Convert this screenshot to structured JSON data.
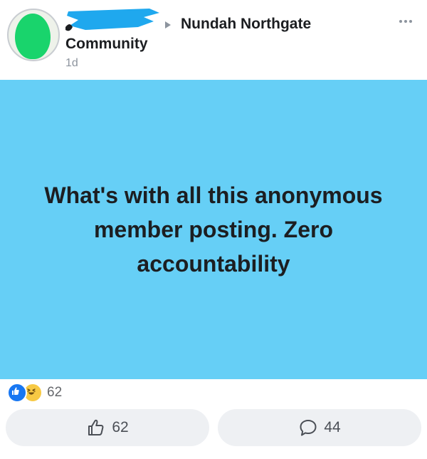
{
  "post": {
    "group_name": "Nundah Northgate",
    "poster_role": "Community",
    "time_ago": "1d",
    "text": "What's with all this anonymous member posting. Zero accountability",
    "background_color": "#66cff6"
  },
  "reactions": {
    "types": [
      "like-icon",
      "haha-icon"
    ],
    "total": "62"
  },
  "actions": {
    "like_count": "62",
    "comment_count": "44"
  },
  "icons": {
    "more": "more-options-icon",
    "like": "thumbs-up-icon",
    "comment": "comment-bubble-icon"
  },
  "colors": {
    "accent": "#1877f2",
    "redaction": "#1fa8ee",
    "avatar_fill": "#19d46c"
  }
}
